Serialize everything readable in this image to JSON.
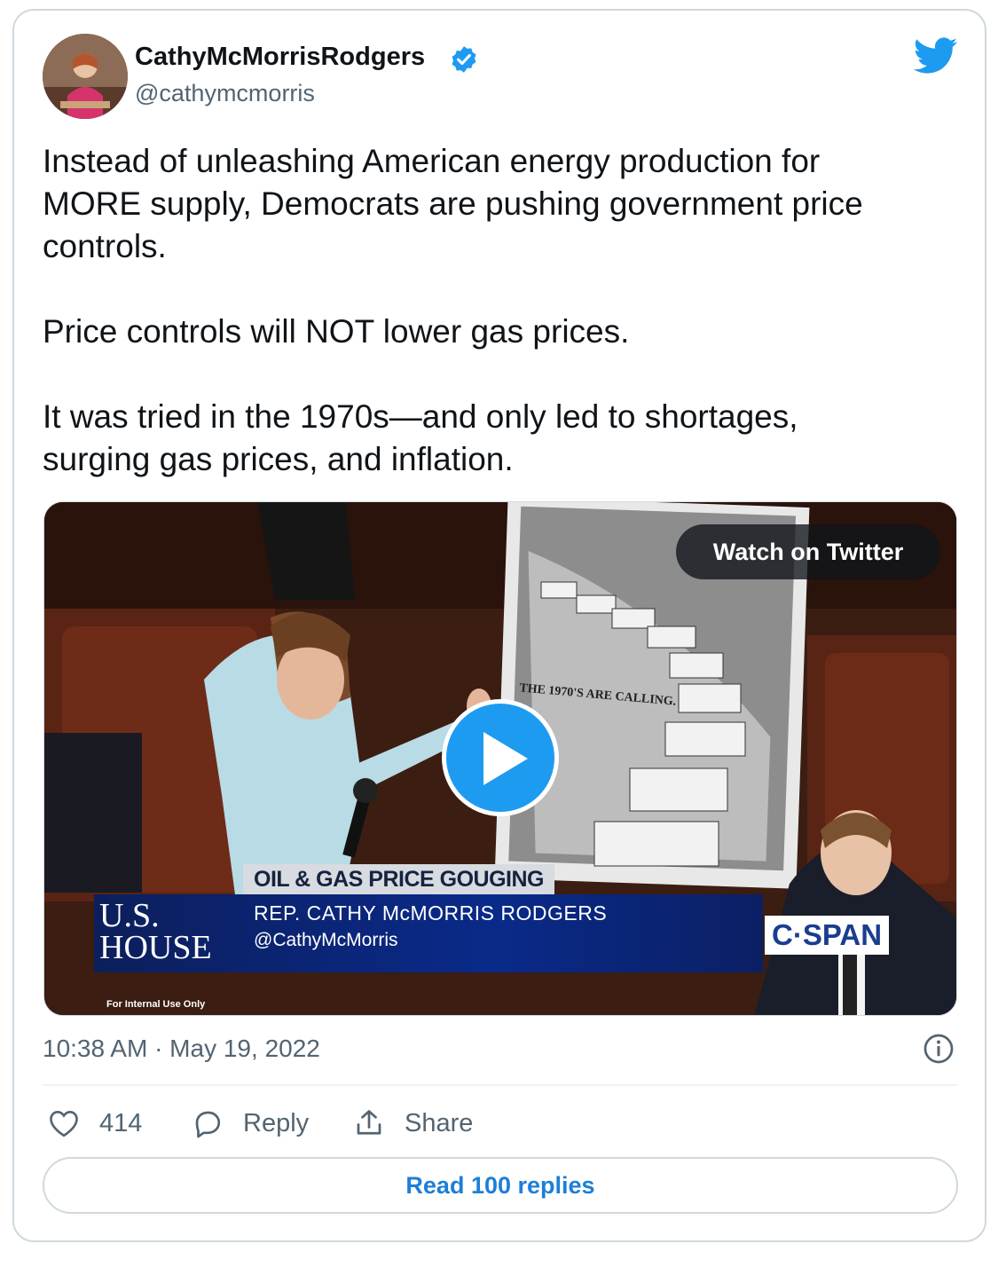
{
  "author": {
    "name": "CathyMcMorrisRodgers",
    "handle": "@cathymcmorris",
    "verified": true,
    "avatar_icon": "avatar-photo"
  },
  "platform_icon": "twitter-bird-icon",
  "tweet": {
    "text": "Instead of unleashing American energy production for\nMORE supply, Democrats are pushing government price\ncontrols.\n\nPrice controls will NOT lower gas prices.\n\nIt was tried in the 1970s—and only led to shortages,\nsurging gas prices, and inflation."
  },
  "media": {
    "watch_label": "Watch on Twitter",
    "sign_caption": "THE 1970'S ARE CALLING.",
    "chyron_topic": "OIL & GAS PRICE GOUGING",
    "network_left_line1": "U.S.",
    "network_left_line2": "HOUSE",
    "speaker_name": "REP. CATHY McMORRIS RODGERS",
    "speaker_handle": "@CathyMcMorris",
    "network_logo": "C·SPAN",
    "footer_note": "For Internal Use Only"
  },
  "meta": {
    "timestamp": "10:38 AM · May 19, 2022"
  },
  "actions": {
    "like_count": "414",
    "reply_label": "Reply",
    "share_label": "Share"
  },
  "read_replies_label": "Read 100 replies",
  "colors": {
    "accent": "#1d9bf0",
    "text": "#0f1419",
    "muted": "#536471",
    "border": "#cfd9de"
  }
}
